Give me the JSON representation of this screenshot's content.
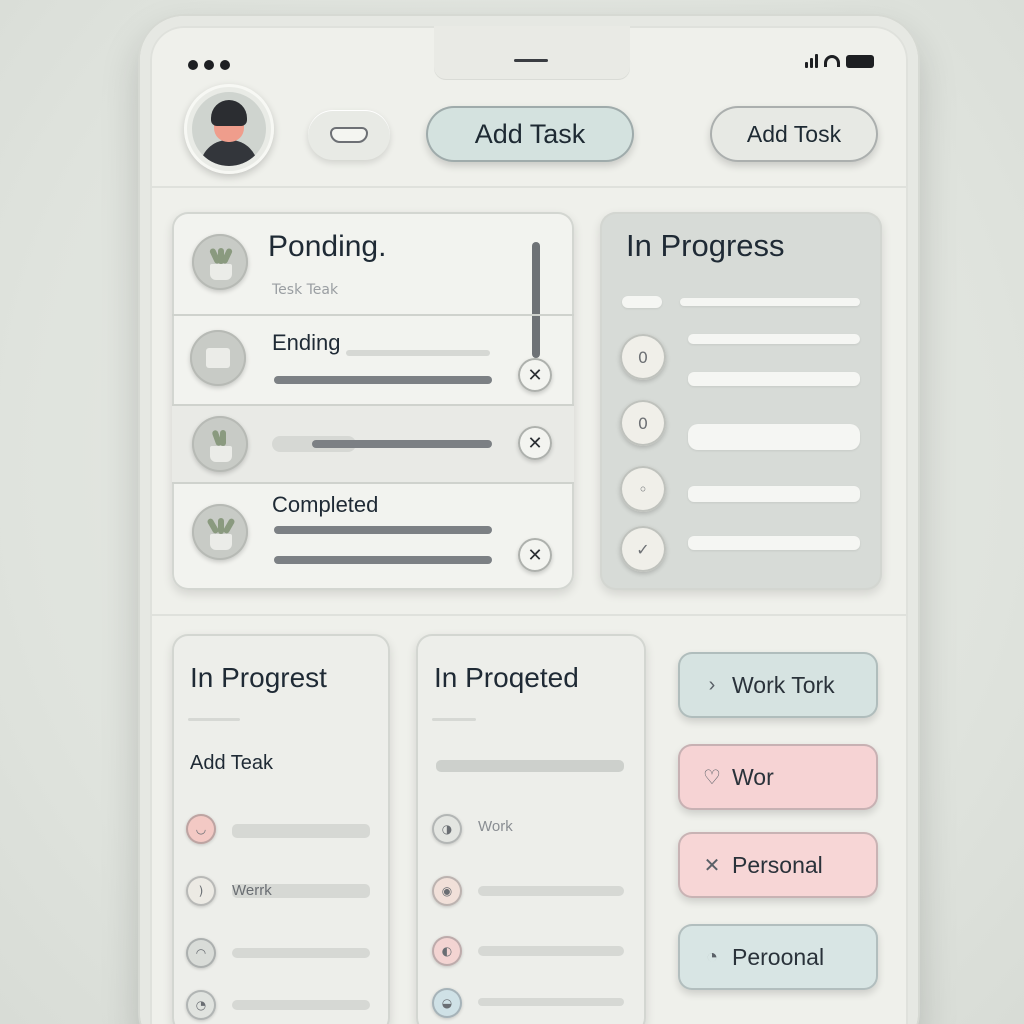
{
  "header": {
    "add_task_primary": "Add Task",
    "add_task_secondary": "Add Tosk"
  },
  "pending_panel": {
    "title": "Ponding.",
    "subtitle": "Tesk Teak",
    "rows": [
      {
        "label": "Ending"
      },
      {
        "label": ""
      },
      {
        "label": "Completed"
      }
    ]
  },
  "in_progress_panel": {
    "title": "In Progress",
    "items": [
      {
        "glyph": "0"
      },
      {
        "glyph": "0"
      },
      {
        "glyph": "◦"
      },
      {
        "glyph": "✓"
      }
    ]
  },
  "in_progress_panel_2": {
    "title": "In Progrest",
    "action_label": "Add Teak",
    "items": [
      {
        "label": "",
        "color": "#f3c9c4"
      },
      {
        "label": "Werrk",
        "color": "#eceae4"
      },
      {
        "label": "",
        "color": "#d9dcd8"
      },
      {
        "label": "",
        "color": "#e0e3df"
      }
    ]
  },
  "projected_panel": {
    "title": "In Proqeted",
    "items": [
      {
        "label": "Work",
        "color": "#e3e5e1"
      },
      {
        "label": "",
        "color": "#f1e0d9"
      },
      {
        "label": "",
        "color": "#f3d4d2"
      },
      {
        "label": "",
        "color": "#cfe1e6"
      }
    ]
  },
  "tags": [
    {
      "label": "Work Tork",
      "icon": "›",
      "color": "#d6e3e1"
    },
    {
      "label": "Wor",
      "icon": "♡",
      "color": "#f6d3d4"
    },
    {
      "label": "Personal",
      "icon": "✕",
      "color": "#f7d6d6"
    },
    {
      "label": "Peroonal",
      "icon": "◔",
      "color": "#d8e5e4"
    }
  ],
  "colors": {
    "accent_teal": "#d4e2df",
    "accent_pink": "#f6d3d4",
    "text_dark": "#1f2a35"
  }
}
